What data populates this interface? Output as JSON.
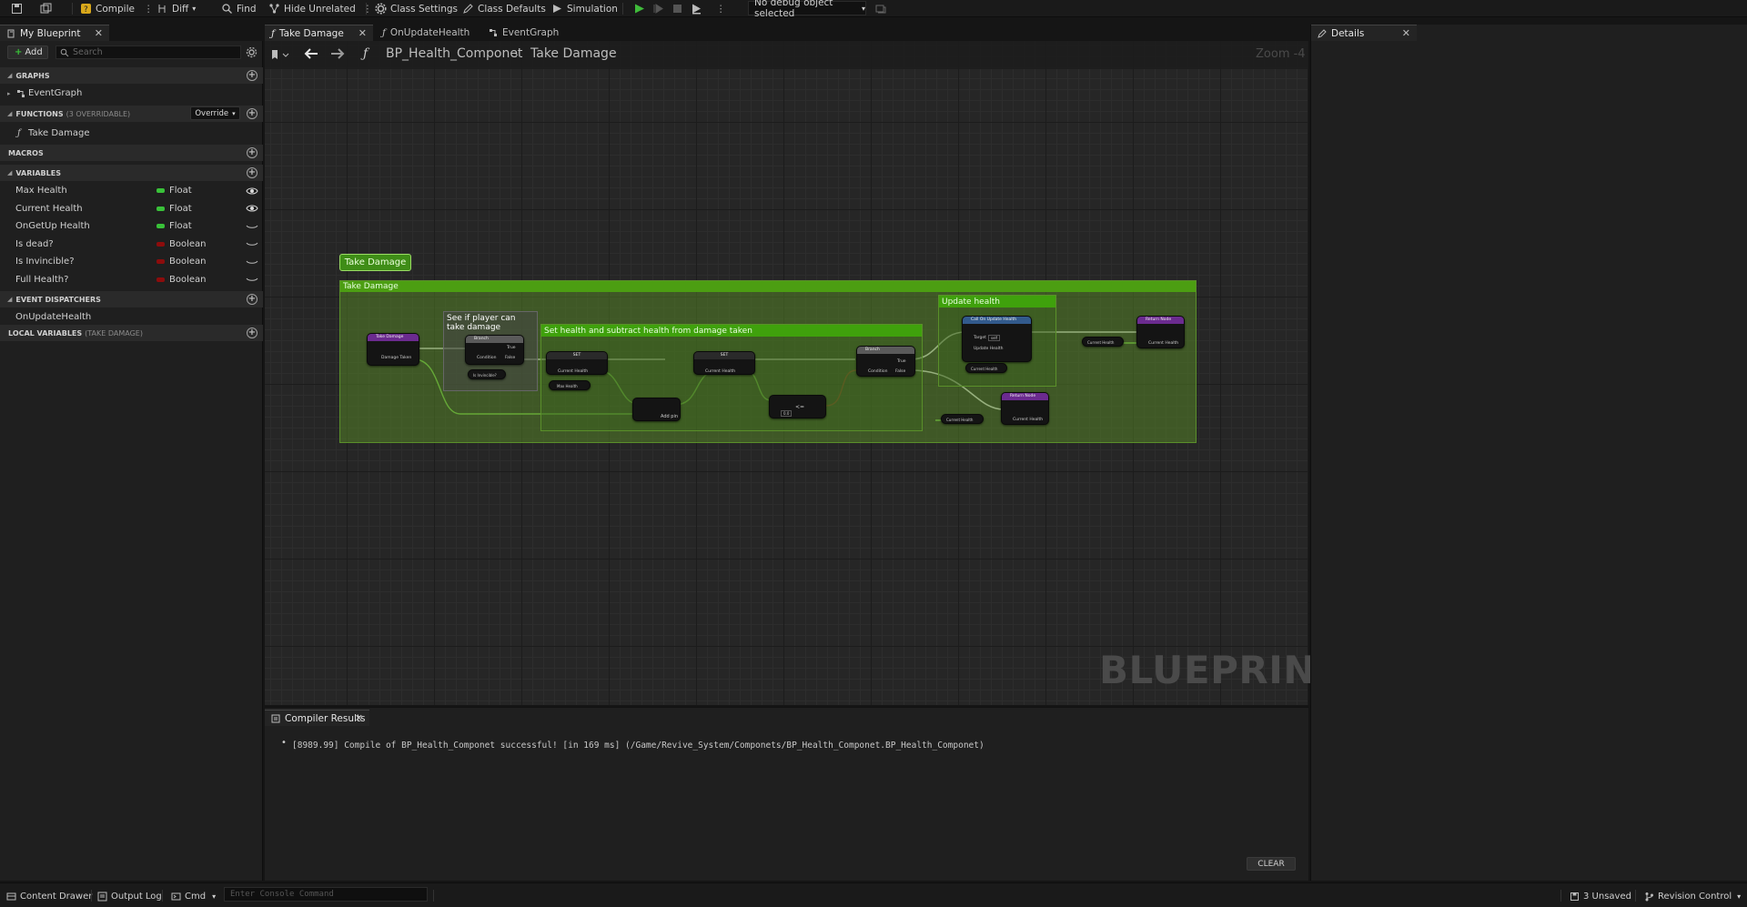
{
  "toolbar": {
    "compile": "Compile",
    "diff": "Diff",
    "find": "Find",
    "hide_unrelated": "Hide Unrelated",
    "class_settings": "Class Settings",
    "class_defaults": "Class Defaults",
    "simulation": "Simulation",
    "debug_object": "No debug object selected"
  },
  "left_panel": {
    "tab_title": "My Blueprint",
    "add_label": "Add",
    "search_placeholder": "Search",
    "graphs_header": "GRAPHS",
    "event_graph_item": "EventGraph",
    "functions_header": "FUNCTIONS",
    "functions_sub": "(3 OVERRIDABLE)",
    "override_label": "Override",
    "function_item": "Take Damage",
    "macros_header": "MACROS",
    "variables_header": "VARIABLES",
    "variables": [
      {
        "name": "Max Health",
        "type": "Float",
        "color": "#39c139"
      },
      {
        "name": "Current Health",
        "type": "Float",
        "color": "#39c139"
      },
      {
        "name": "OnGetUp Health",
        "type": "Float",
        "color": "#39c139"
      },
      {
        "name": "Is dead?",
        "type": "Boolean",
        "color": "#8c0c0c"
      },
      {
        "name": "Is Invincible?",
        "type": "Boolean",
        "color": "#8c0c0c"
      },
      {
        "name": "Full Health?",
        "type": "Boolean",
        "color": "#8c0c0c"
      }
    ],
    "event_dispatchers_header": "EVENT DISPATCHERS",
    "dispatcher_item": "OnUpdateHealth",
    "local_variables_header": "LOCAL VARIABLES",
    "local_variables_sub": "(TAKE DAMAGE)"
  },
  "tabs": [
    {
      "label": "Take Damage"
    },
    {
      "label": "OnUpdateHealth"
    },
    {
      "label": "EventGraph"
    }
  ],
  "graph": {
    "breadcrumb_root": "BP_Health_Componet",
    "breadcrumb_leaf": "Take Damage",
    "zoom": "Zoom -4",
    "watermark": "BLUEPRINT",
    "entry_button": "Take Damage",
    "comments": {
      "outer": "Take Damage",
      "check": "See if player can take damage",
      "subtract": "Set health and subtract health from damage taken",
      "update": "Update health"
    },
    "nodes": {
      "entry": "Take Damage",
      "entry_pin": "Damage Taken",
      "branch1": "Branch",
      "true": "True",
      "false": "False",
      "condition": "Condition",
      "is_invincible": "Is Invincible?",
      "set1": "SET",
      "set2": "SET",
      "current_health": "Current Health",
      "max_health": "Max Health",
      "add_pin": "Add pin",
      "less_eq": "<=",
      "zero": "0.0",
      "branch2": "Branch",
      "call_update": "Call On Update Health",
      "target": "Target",
      "self": "self",
      "update_health": "Update Health",
      "return1": "Return Node",
      "return2": "Return Node"
    }
  },
  "compiler": {
    "tab_title": "Compiler Results",
    "log": "[8989.99] Compile of BP_Health_Componet successful! [in 169 ms] (/Game/Revive_System/Componets/BP_Health_Componet.BP_Health_Componet)",
    "clear": "CLEAR"
  },
  "right_panel": {
    "tab_title": "Details"
  },
  "bottom_bar": {
    "content_drawer": "Content Drawer",
    "output_log": "Output Log",
    "cmd": "Cmd",
    "console_placeholder": "Enter Console Command",
    "unsaved": "3 Unsaved",
    "revision_control": "Revision Control"
  }
}
